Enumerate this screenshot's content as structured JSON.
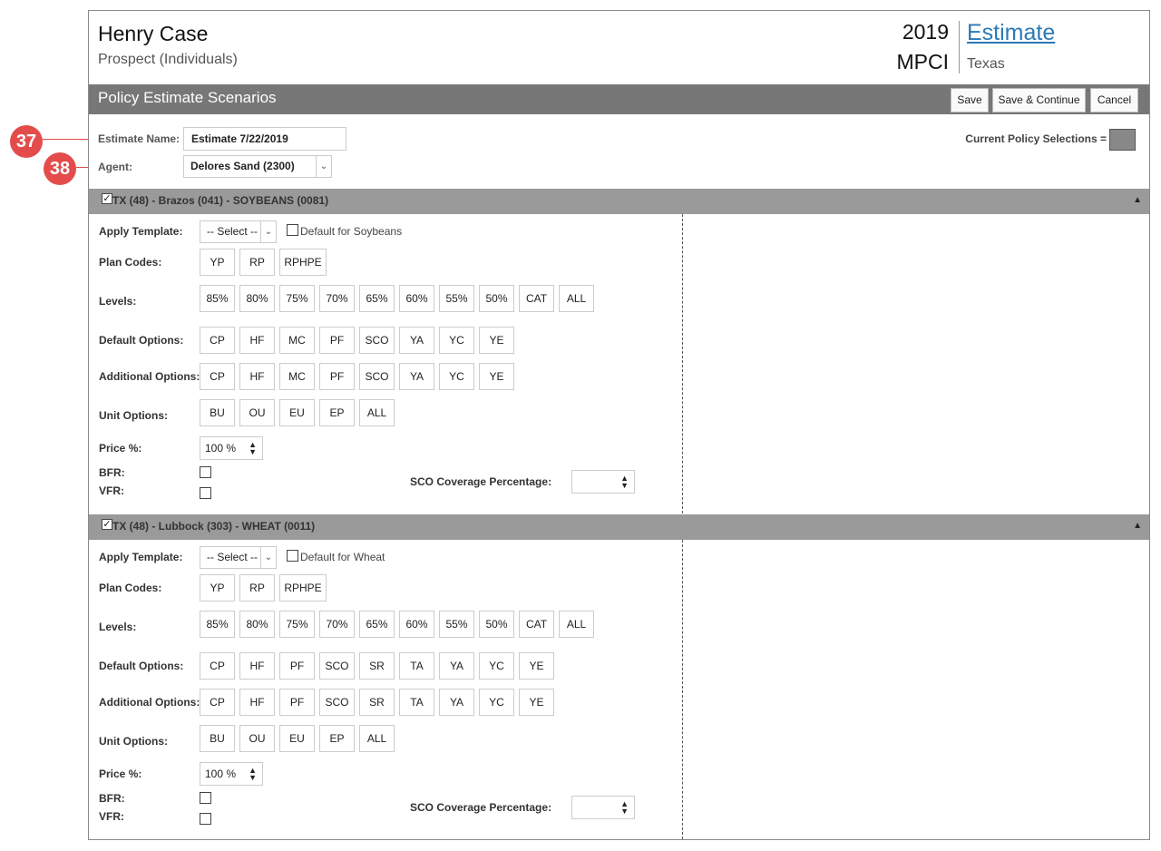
{
  "header": {
    "client_name": "Henry Case",
    "client_type": "Prospect (Individuals)",
    "year": "2019",
    "program": "MPCI",
    "estimate_link": "Estimate",
    "state": "Texas"
  },
  "section": {
    "title": "Policy Estimate Scenarios",
    "save_label": "Save",
    "save_continue_label": "Save & Continue",
    "cancel_label": "Cancel"
  },
  "form": {
    "estimate_name_label": "Estimate Name:",
    "estimate_name_value": "Estimate 7/22/2019",
    "agent_label": "Agent:",
    "agent_value": "Delores Sand (2300)",
    "current_selections_label": "Current Policy Selections =",
    "current_selections_color": "#888888"
  },
  "callouts": [
    "37",
    "38"
  ],
  "labels": {
    "apply_template": "Apply Template:",
    "plan_codes": "Plan Codes:",
    "levels": "Levels:",
    "default_options": "Default Options:",
    "additional_options": "Additional Options:",
    "unit_options": "Unit Options:",
    "price": "Price %:",
    "bfr": "BFR:",
    "vfr": "VFR:",
    "sco": "SCO Coverage Percentage:"
  },
  "counties": [
    {
      "title": "TX (48) - Brazos (041) - SOYBEANS (0081)",
      "template_value": "-- Select --",
      "default_for": "Default for Soybeans",
      "plan_codes": [
        "YP",
        "RP",
        "RPHPE"
      ],
      "levels": [
        "85%",
        "80%",
        "75%",
        "70%",
        "65%",
        "60%",
        "55%",
        "50%",
        "CAT",
        "ALL"
      ],
      "default_options": [
        "CP",
        "HF",
        "MC",
        "PF",
        "SCO",
        "YA",
        "YC",
        "YE"
      ],
      "additional_options": [
        "CP",
        "HF",
        "MC",
        "PF",
        "SCO",
        "YA",
        "YC",
        "YE"
      ],
      "unit_options": [
        "BU",
        "OU",
        "EU",
        "EP",
        "ALL"
      ],
      "price": "100 %"
    },
    {
      "title": "TX (48) - Lubbock (303) - WHEAT (0011)",
      "template_value": "-- Select --",
      "default_for": "Default for Wheat",
      "plan_codes": [
        "YP",
        "RP",
        "RPHPE"
      ],
      "levels": [
        "85%",
        "80%",
        "75%",
        "70%",
        "65%",
        "60%",
        "55%",
        "50%",
        "CAT",
        "ALL"
      ],
      "default_options": [
        "CP",
        "HF",
        "PF",
        "SCO",
        "SR",
        "TA",
        "YA",
        "YC",
        "YE"
      ],
      "additional_options": [
        "CP",
        "HF",
        "PF",
        "SCO",
        "SR",
        "TA",
        "YA",
        "YC",
        "YE"
      ],
      "unit_options": [
        "BU",
        "OU",
        "EU",
        "EP",
        "ALL"
      ],
      "price": "100 %"
    }
  ]
}
